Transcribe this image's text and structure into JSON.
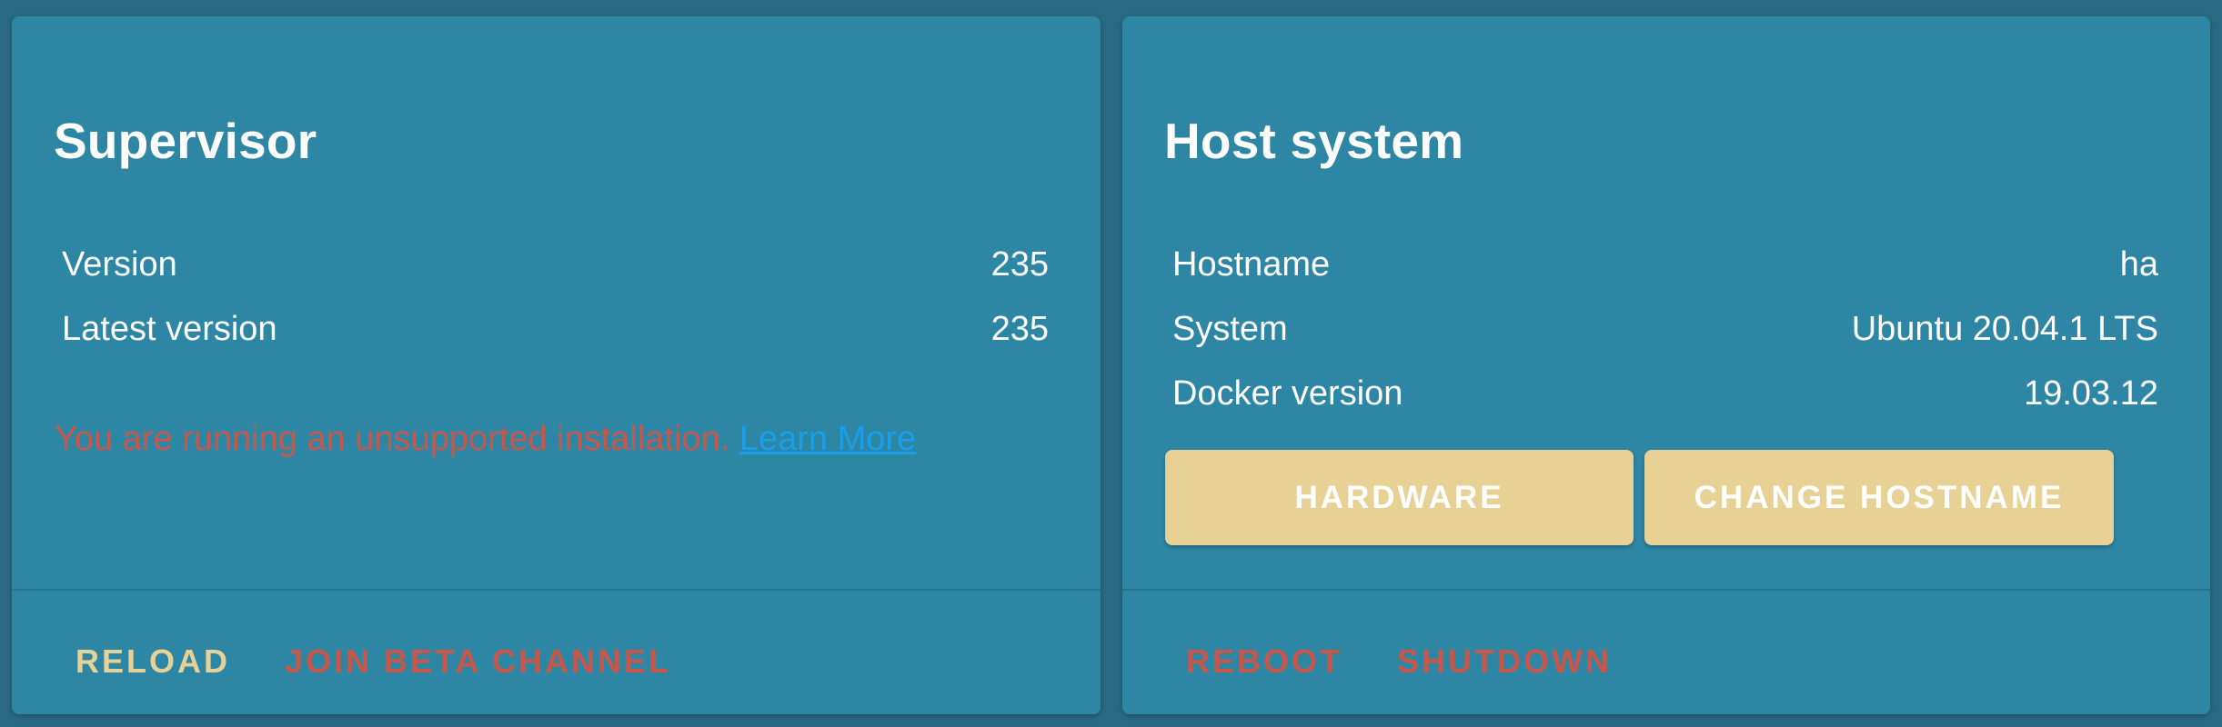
{
  "supervisor": {
    "title": "Supervisor",
    "rows": [
      {
        "label": "Version",
        "value": "235"
      },
      {
        "label": "Latest version",
        "value": "235"
      }
    ],
    "warning_text": "You are running an unsupported installation.",
    "learn_more_label": "Learn More",
    "actions": {
      "reload_label": "RELOAD",
      "join_beta_label": "JOIN BETA CHANNEL"
    }
  },
  "host": {
    "title": "Host system",
    "rows": [
      {
        "label": "Hostname",
        "value": "ha"
      },
      {
        "label": "System",
        "value": "Ubuntu 20.04.1 LTS"
      },
      {
        "label": "Docker version",
        "value": "19.03.12"
      }
    ],
    "buttons": {
      "hardware_label": "HARDWARE",
      "change_hostname_label": "CHANGE HOSTNAME"
    },
    "actions": {
      "reboot_label": "REBOOT",
      "shutdown_label": "SHUTDOWN"
    }
  },
  "colors": {
    "background": "#2a6a81",
    "card": "#2e86a5",
    "accent": "#e8d195",
    "danger": "#c8574a",
    "link": "#1a9fe8"
  }
}
